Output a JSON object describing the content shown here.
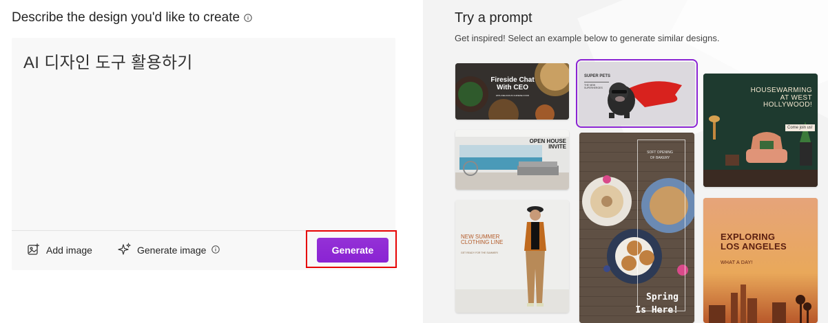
{
  "left_panel": {
    "heading": "Describe the design you'd like to create",
    "prompt_value": "AI 디자인 도구 활용하기",
    "add_image_label": "Add image",
    "generate_image_label": "Generate image",
    "generate_button_label": "Generate",
    "accent_color": "#8a23d3",
    "highlight_color": "#e60000"
  },
  "right_panel": {
    "title": "Try a prompt",
    "subtitle": "Get inspired! Select an example below to generate similar designs.",
    "cards": {
      "fireside": {
        "line1": "Fireside Chat",
        "line2": "With CEO",
        "small": "WITH DELICIOUS CHINESE FOOD"
      },
      "superpets": {
        "title": "SUPER PETS",
        "small1": "THE NEW",
        "small2": "SUPERHEROES",
        "selected": true
      },
      "housewarming": {
        "line1": "HOUSEWARMING",
        "line2": "AT WEST",
        "line3": "HOLLYWOOD!",
        "tag": "Come join us!"
      },
      "openhouse": {
        "line1": "OPEN HOUSE",
        "line2": "INVITE"
      },
      "bakery": {
        "small1": "SOFT OPENING",
        "small2": "OF BAKERY",
        "line1": "Spring",
        "line2": "Is Here!"
      },
      "summer": {
        "line1": "NEW SUMMER",
        "line2": "CLOTHING LINE",
        "small": "GET READY FOR THE SUMMER!"
      },
      "la": {
        "line1": "EXPLORING",
        "line2": "LOS ANGELES",
        "small": "WHAT A DAY!"
      }
    }
  }
}
